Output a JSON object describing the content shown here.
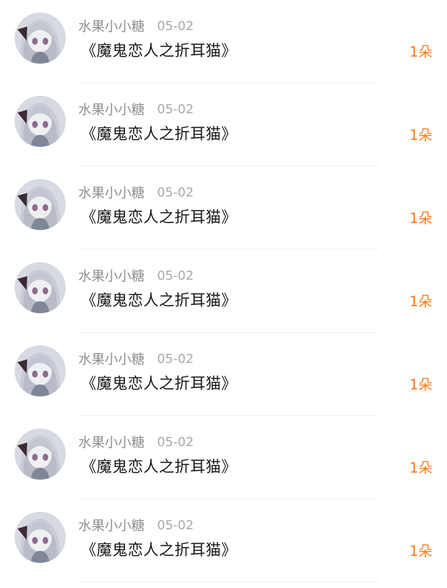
{
  "colors": {
    "username": "#8f8f8f",
    "date": "#a8a8a8",
    "gift_text": "#1a1a1a",
    "count": "#ff7a1a",
    "divider": "#efefef"
  },
  "items": [
    {
      "username": "水果小小糖",
      "date": "05-02",
      "gift": "《魔鬼恋人之折耳猫》",
      "count": "1朵",
      "avatar_icon": "anime-girl-avatar"
    },
    {
      "username": "水果小小糖",
      "date": "05-02",
      "gift": "《魔鬼恋人之折耳猫》",
      "count": "1朵",
      "avatar_icon": "anime-girl-avatar"
    },
    {
      "username": "水果小小糖",
      "date": "05-02",
      "gift": "《魔鬼恋人之折耳猫》",
      "count": "1朵",
      "avatar_icon": "anime-girl-avatar"
    },
    {
      "username": "水果小小糖",
      "date": "05-02",
      "gift": "《魔鬼恋人之折耳猫》",
      "count": "1朵",
      "avatar_icon": "anime-girl-avatar"
    },
    {
      "username": "水果小小糖",
      "date": "05-02",
      "gift": "《魔鬼恋人之折耳猫》",
      "count": "1朵",
      "avatar_icon": "anime-girl-avatar"
    },
    {
      "username": "水果小小糖",
      "date": "05-02",
      "gift": "《魔鬼恋人之折耳猫》",
      "count": "1朵",
      "avatar_icon": "anime-girl-avatar"
    },
    {
      "username": "水果小小糖",
      "date": "05-02",
      "gift": "《魔鬼恋人之折耳猫》",
      "count": "1朵",
      "avatar_icon": "anime-girl-avatar"
    }
  ]
}
